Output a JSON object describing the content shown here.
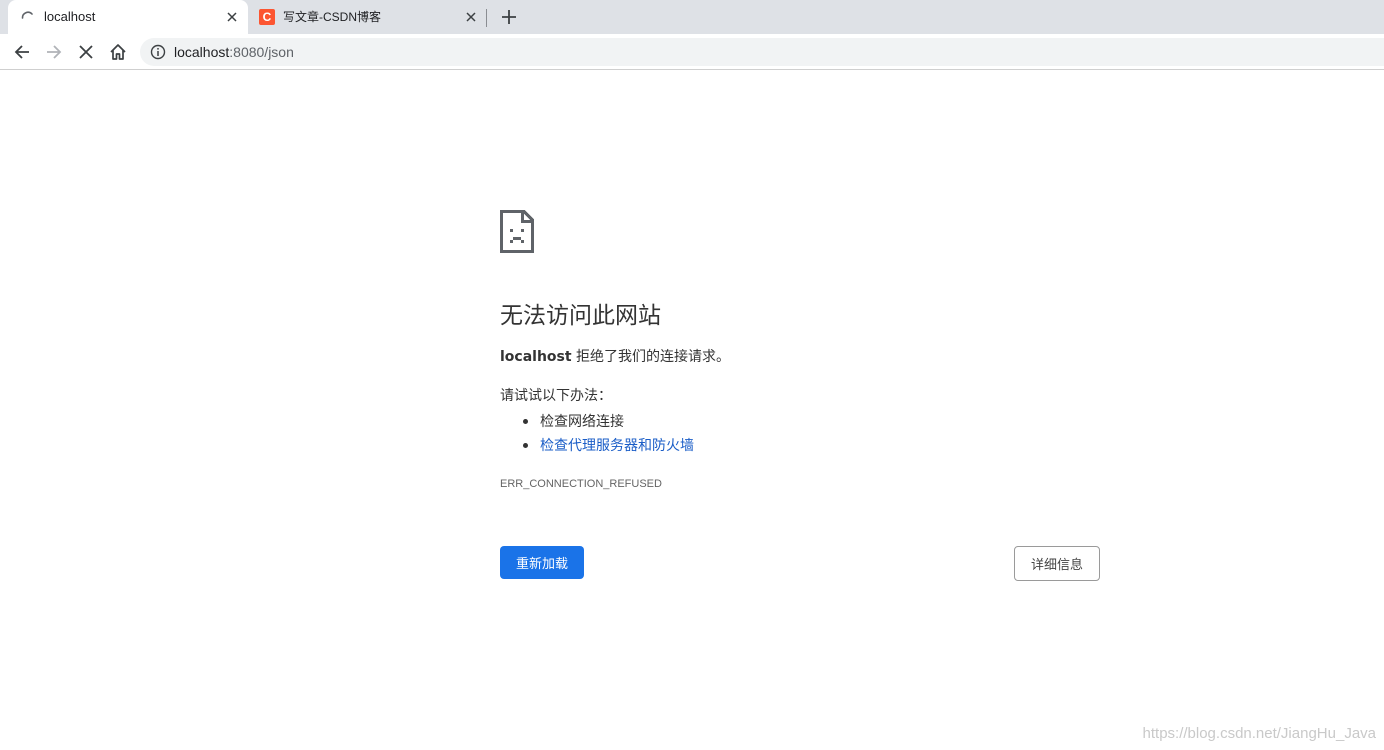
{
  "tabs": [
    {
      "title": "localhost",
      "state": "loading",
      "active": true
    },
    {
      "title": "写文章-CSDN博客",
      "favicon_letter": "C",
      "favicon_color": "#fc5531",
      "active": false
    }
  ],
  "toolbar": {
    "url_host": "localhost",
    "url_rest": ":8080/json",
    "icons": [
      "back-arrow-icon",
      "forward-arrow-icon",
      "stop-icon",
      "home-icon",
      "info-icon"
    ]
  },
  "error": {
    "heading": "无法访问此网站",
    "host": "localhost",
    "message": " 拒绝了我们的连接请求。",
    "try_label": "请试试以下办法：",
    "suggestions": [
      {
        "text": "检查网络连接",
        "is_link": false
      },
      {
        "text": "检查代理服务器和防火墙",
        "is_link": true
      }
    ],
    "code": "ERR_CONNECTION_REFUSED",
    "reload_label": "重新加载",
    "details_label": "详细信息"
  },
  "colors": {
    "primary_button": "#1a73e8",
    "link": "#1a5dc7",
    "tabstrip_bg": "#dee1e6"
  },
  "watermark": "https://blog.csdn.net/JiangHu_Java"
}
